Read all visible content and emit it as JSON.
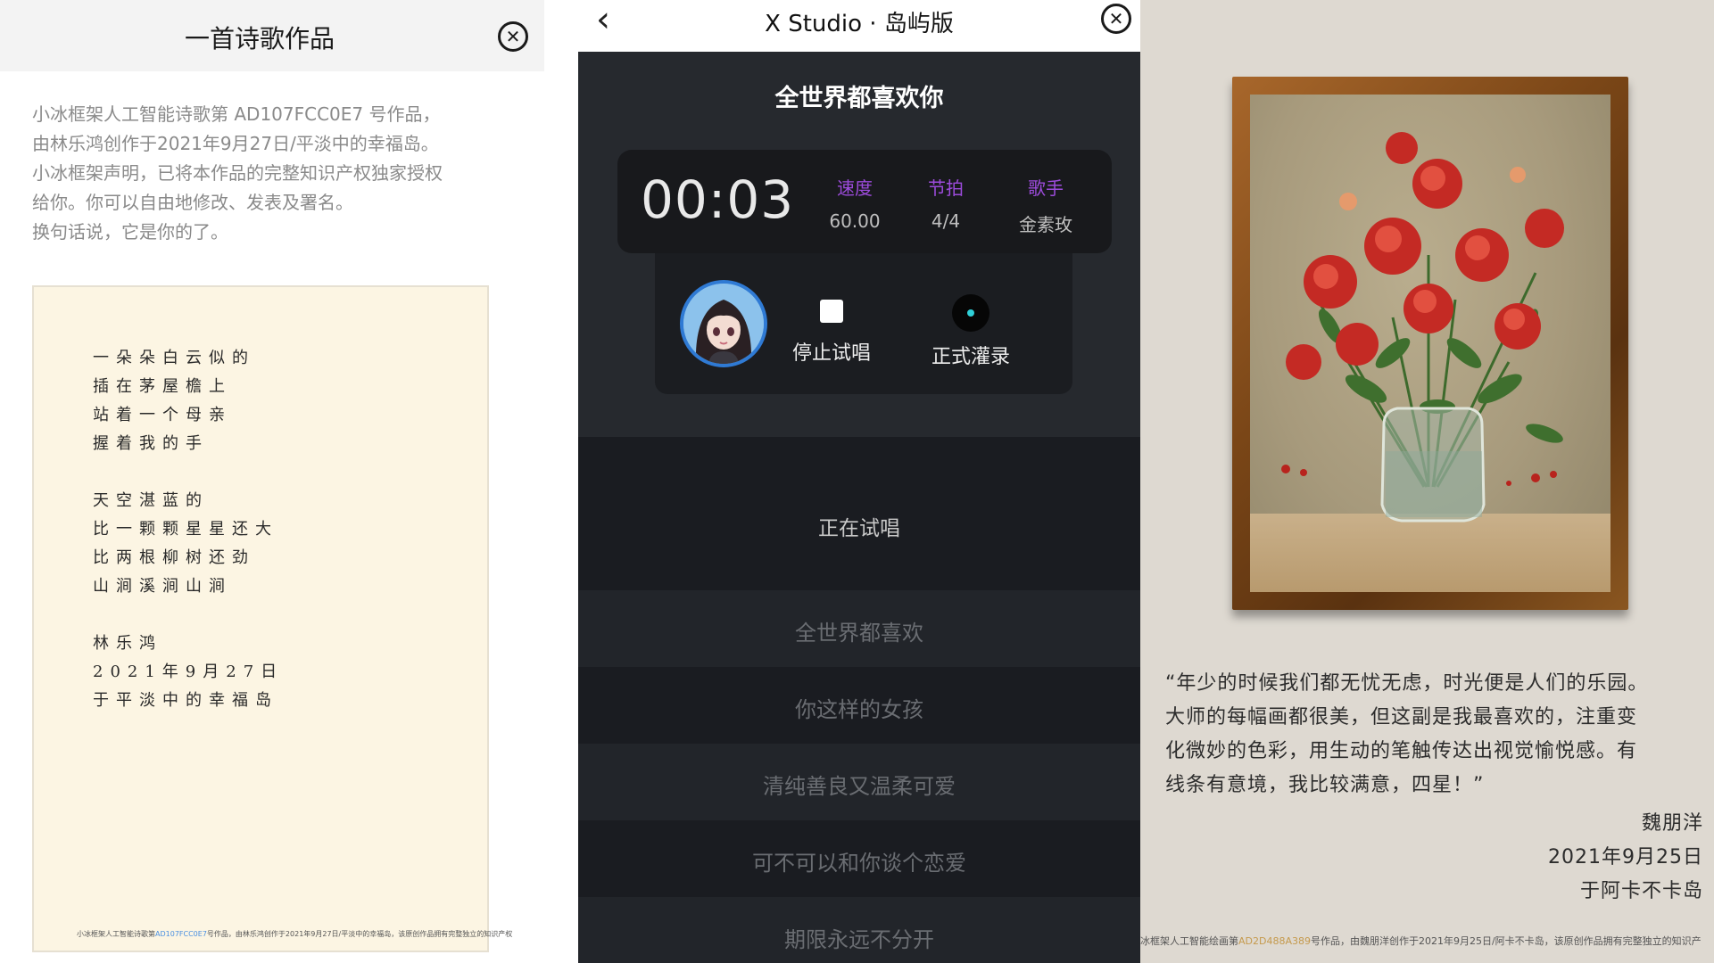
{
  "poem_panel": {
    "title": "一首诗歌作品",
    "intro": [
      "小冰框架人工智能诗歌第 AD107FCC0E7 号作品，",
      "由林乐鸿创作于2021年9月27日/平淡中的幸福岛。",
      "小冰框架声明，已将本作品的完整知识产权独家授权",
      "给你。你可以自由地修改、发表及署名。",
      "换句话说，它是你的了。"
    ],
    "poem_stanza1": [
      "一朵朵白云似的",
      "插在茅屋檐上",
      "站着一个母亲",
      "握着我的手"
    ],
    "poem_stanza2": [
      "天空湛蓝的",
      "比一颗颗星星还大",
      "比两根柳树还劲",
      "山涧溪涧山涧"
    ],
    "poem_signature": [
      "林乐鸿",
      "2021年9月27日",
      "于平淡中的幸福岛"
    ],
    "footer_prefix": "小冰框架人工智能诗歌第",
    "footer_code": "AD107FCC0E7",
    "footer_suffix": "号作品，由林乐鸿创作于2021年9月27日/平淡中的幸福岛，该原创作品拥有完整独立的知识产权"
  },
  "studio_panel": {
    "app_title": "X Studio · 岛屿版",
    "back_icon": "‹",
    "song_title": "全世界都喜欢你",
    "timer": "00:03",
    "stats": [
      {
        "key": "速度",
        "value": "60.00"
      },
      {
        "key": "节拍",
        "value": "4/4"
      },
      {
        "key": "歌手",
        "value": "金素玫"
      }
    ],
    "stop_label": "停止试唱",
    "record_label": "正式灌录",
    "status": "正在试唱",
    "lyrics": [
      "全世界都喜欢",
      "你这样的女孩",
      "清纯善良又温柔可爱",
      "可不可以和你谈个恋爱",
      "期限永远不分开"
    ],
    "accent_color": "#9c4bdb"
  },
  "painting_panel": {
    "quote": [
      "“年少的时候我们都无忧无虑，时光便是人们的乐园。",
      "大师的每幅画都很美，但这副是我最喜欢的，注重变",
      "化微妙的色彩，用生动的笔触传达出视觉愉悦感。有",
      "线条有意境，我比较满意，四星！”"
    ],
    "author": "魏朋洋",
    "date": "2021年9月25日",
    "place": "于阿卡不卡岛",
    "footer_prefix": "冰框架人工智能绘画第",
    "footer_code": "AD2D488A389",
    "footer_suffix": "号作品，由魏朋洋创作于2021年9月25日/阿卡不卡岛，该原创作品拥有完整独立的知识产"
  }
}
